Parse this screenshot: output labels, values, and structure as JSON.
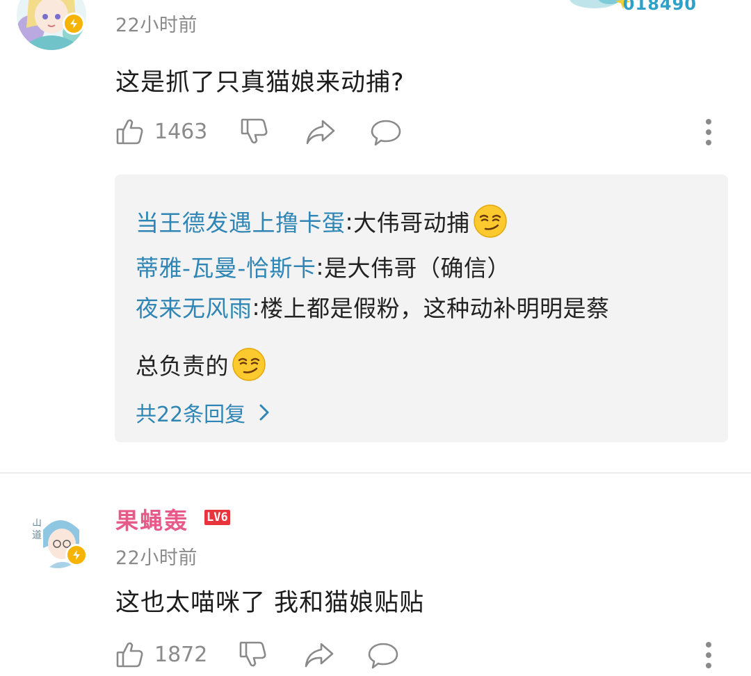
{
  "top_partial": {
    "number_text": "018490"
  },
  "comment1": {
    "time": "22小时前",
    "text": "这是抓了只真猫娘来动捕?",
    "like_count": "1463",
    "replies": [
      {
        "author": "当王德发遇上撸卡蛋",
        "separator": ": ",
        "text": "大伟哥动捕",
        "emoji": "smirk-emoji"
      },
      {
        "author": "蒂雅-瓦曼-恰斯卡",
        "separator": ": ",
        "text": "是大伟哥（确信）"
      },
      {
        "author": "夜来无风雨",
        "separator": ": ",
        "text": "楼上都是假粉，这种动补明明是蔡",
        "continuation": "总负责的",
        "emoji": "smirk-emoji"
      }
    ],
    "more_replies": "共22条回复"
  },
  "comment2": {
    "username": "果蝇轰",
    "level": "LV6",
    "time": "22小时前",
    "text": "这也太喵咪了 我和猫娘贴贴",
    "like_count": "1872"
  },
  "colors": {
    "reply_author": "#2f86b5",
    "username": "#e65a8a",
    "level_badge": "#e8343c",
    "meta_gray": "#8a8a8a"
  },
  "icons": [
    "like-icon",
    "dislike-icon",
    "share-icon",
    "comment-icon",
    "more-icon",
    "chevron-right-icon",
    "smirk-emoji",
    "vip-badge-icon"
  ]
}
